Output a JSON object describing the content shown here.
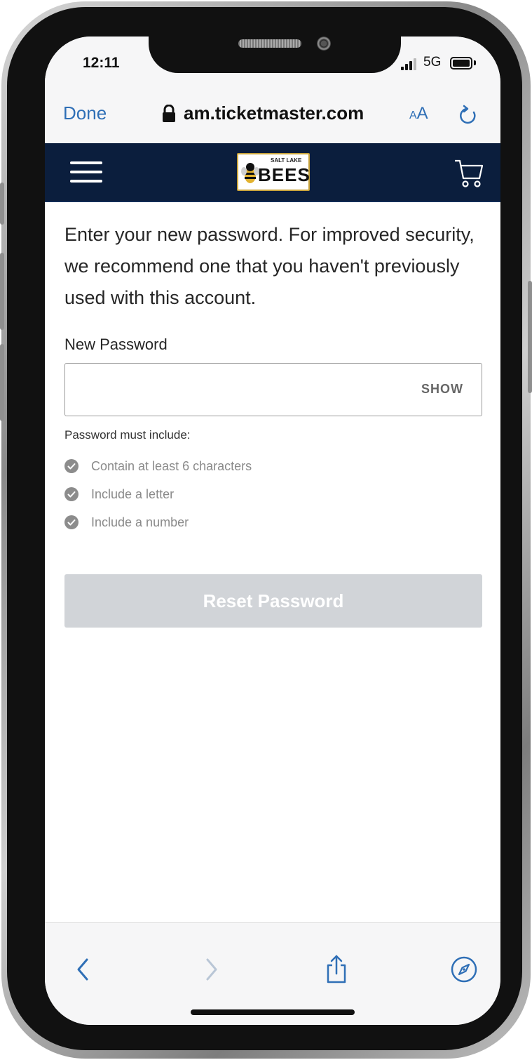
{
  "status_bar": {
    "time": "12:11",
    "network": "5G"
  },
  "browser": {
    "done_label": "Done",
    "url": "am.ticketmaster.com",
    "text_size_label_small": "A",
    "text_size_label_big": "A"
  },
  "header": {
    "logo_small_text": "SALT LAKE",
    "logo_big_text": "BEES",
    "brand_color": "#0b1e3d"
  },
  "main": {
    "intro_text": "Enter your new password. For improved security, we recommend one that you haven't previously used with this account.",
    "password_label": "New Password",
    "password_value": "",
    "show_label": "SHOW",
    "requirements_title": "Password must include:",
    "requirements": [
      {
        "text": "Contain at least 6 characters"
      },
      {
        "text": "Include a letter"
      },
      {
        "text": "Include a number"
      }
    ],
    "reset_button_label": "Reset Password"
  },
  "toolbar": {
    "icons": [
      "back-icon",
      "forward-icon",
      "share-icon",
      "compass-icon"
    ]
  }
}
